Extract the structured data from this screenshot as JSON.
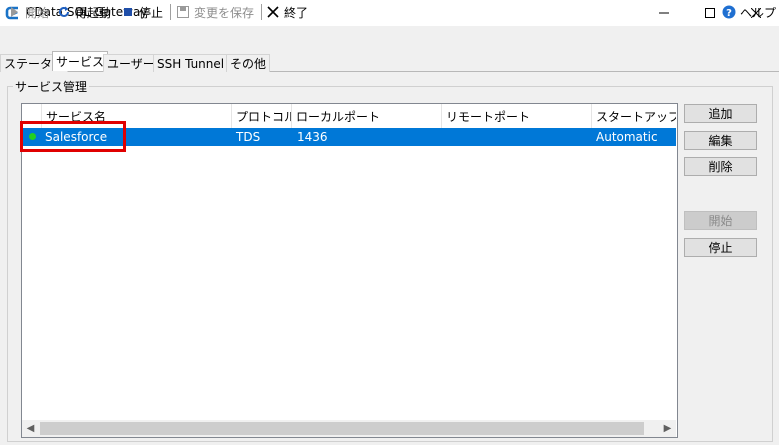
{
  "window": {
    "title": "CData SQL Gateway"
  },
  "toolbar": {
    "start_label": "開始",
    "restart_label": "再起動",
    "stop_label": "停止",
    "save_label": "変更を保存",
    "exit_label": "終了",
    "help_label": "ヘルプ"
  },
  "tabs": [
    {
      "label": "ステータス"
    },
    {
      "label": "サービス"
    },
    {
      "label": "ユーザー"
    },
    {
      "label": "SSH Tunnel"
    },
    {
      "label": "その他"
    }
  ],
  "group": {
    "label": "サービス管理"
  },
  "list": {
    "columns": [
      "サービス名",
      "プロトコル",
      "ローカルポート",
      "リモートポート",
      "スタートアップの種"
    ],
    "rows": [
      {
        "name": "Salesforce",
        "protocol": "TDS",
        "local_port": "1436",
        "remote_port": "",
        "startup": "Automatic",
        "status_color": "#22d022"
      }
    ]
  },
  "buttons": {
    "add": "追加",
    "edit": "編集",
    "delete": "削除",
    "start": "開始",
    "stop": "停止"
  },
  "colors": {
    "selection": "#0078d7",
    "highlight_box": "#e00000"
  }
}
